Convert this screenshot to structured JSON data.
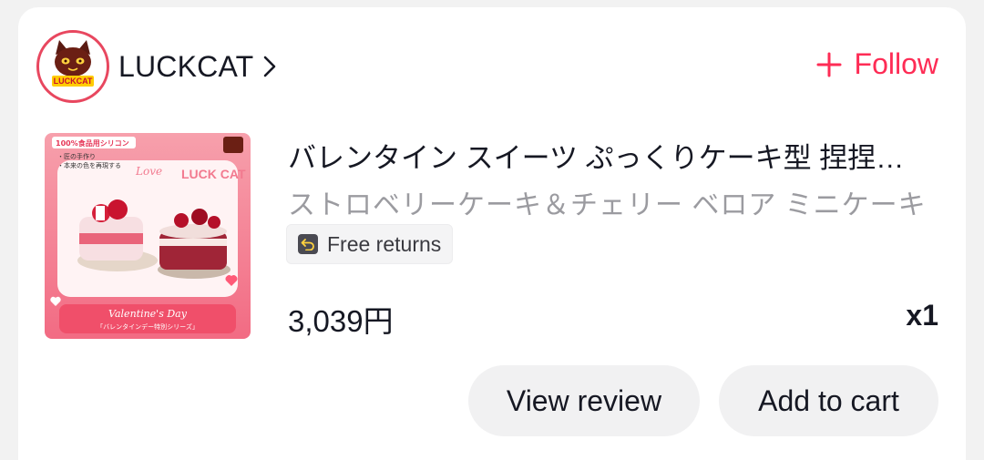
{
  "shop": {
    "name": "LUCKCAT",
    "logo_text": "LUCKCAT",
    "follow_label": "Follow"
  },
  "product": {
    "title": "バレンタイン スイーツ ぷっくりケーキ型 捏捏…",
    "variant": "ストロベリーケーキ＆チェリー ベロア ミニケーキ",
    "badge_label": "Free returns",
    "price": "3,039円",
    "quantity": "x1",
    "image": {
      "tag_top": "100%食品用シリコン",
      "note_1": "・匠の手作り",
      "note_2": "・本来の色を再現する",
      "brand_text": "LUCK CAT",
      "love_text": "Love",
      "banner_title": "Valentine's Day",
      "banner_subtitle": "「バレンタインデー特別シリーズ」"
    }
  },
  "actions": {
    "view_review": "View review",
    "add_to_cart": "Add to cart"
  },
  "colors": {
    "accent": "#fe2c55",
    "avatar_ring": "#e8475f",
    "button_bg": "#f1f1f2",
    "muted_text": "#9b9ba0"
  }
}
